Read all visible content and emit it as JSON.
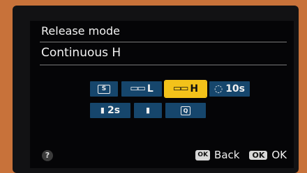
{
  "header": {
    "title": "Release mode",
    "value": "Continuous H"
  },
  "options": [
    {
      "icon": "single-frame-icon",
      "glyph": "S",
      "label": "",
      "selected": false
    },
    {
      "icon": "continuous-icon",
      "glyph": "▭▭",
      "label": "L",
      "selected": false
    },
    {
      "icon": "continuous-icon",
      "glyph": "▭▭",
      "label": "H",
      "selected": true
    },
    {
      "icon": "self-timer-icon",
      "glyph": "◌",
      "label": "10s",
      "selected": false
    },
    {
      "icon": "remote-icon",
      "glyph": "▮",
      "label": "2s",
      "selected": false
    },
    {
      "icon": "remote-icon",
      "glyph": "▮",
      "label": "",
      "selected": false
    },
    {
      "icon": "quiet-shutter-icon",
      "glyph": "Q",
      "label": "",
      "selected": false
    }
  ],
  "footer": {
    "help_glyph": "?",
    "back_key": "OK",
    "back_label": "Back",
    "ok_key": "OK",
    "ok_label": "OK"
  },
  "colors": {
    "accent": "#f3c21a",
    "option_bg": "#16466c",
    "frame": "#c8723a"
  }
}
